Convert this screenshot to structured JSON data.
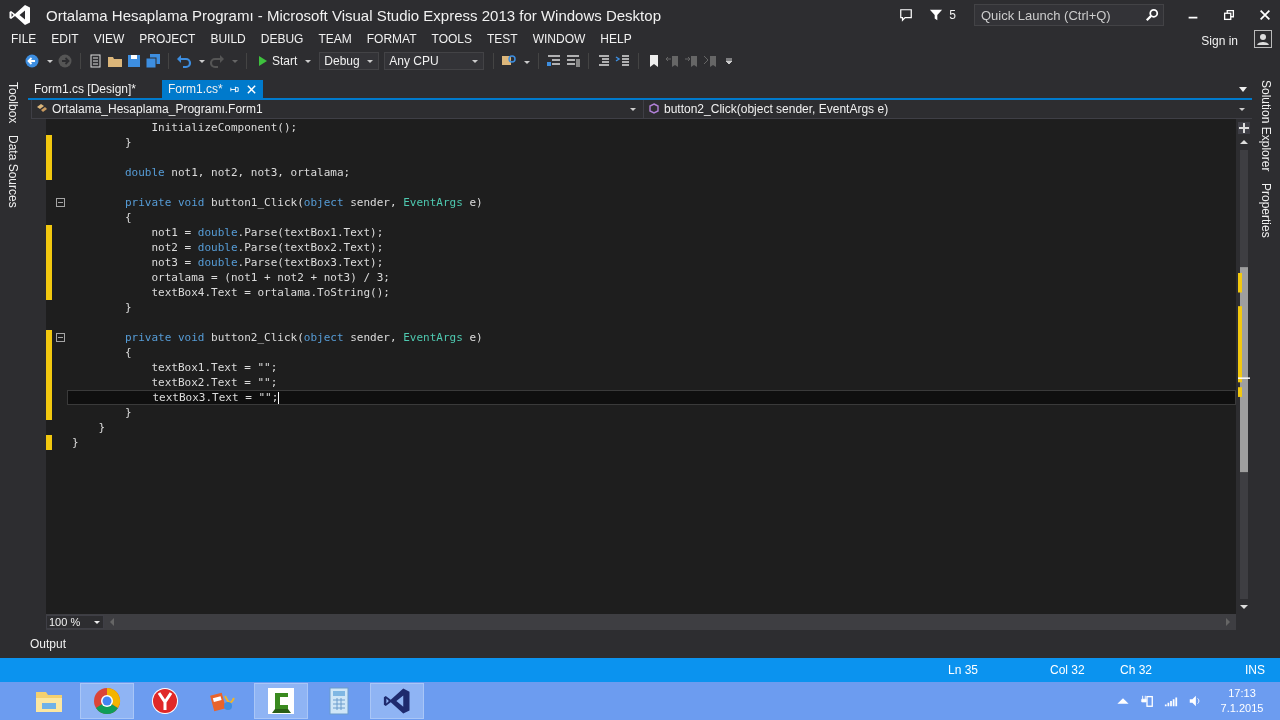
{
  "window": {
    "title": "Ortalama Hesaplama Programı - Microsoft Visual Studio Express 2013 for Windows Desktop"
  },
  "title_bar": {
    "notifications": "5",
    "quick_launch": {
      "placeholder": "Quick Launch (Ctrl+Q)"
    },
    "sign_in": "Sign in"
  },
  "menu": [
    "FILE",
    "EDIT",
    "VIEW",
    "PROJECT",
    "BUILD",
    "DEBUG",
    "TEAM",
    "FORMAT",
    "TOOLS",
    "TEST",
    "WINDOW",
    "HELP"
  ],
  "toolbar": {
    "start": "Start",
    "configuration": "Debug",
    "platform": "Any CPU"
  },
  "side_tabs_left": [
    "Toolbox",
    "Data Sources"
  ],
  "side_tabs_right": [
    "Solution Explorer",
    "Properties"
  ],
  "tabs": [
    {
      "label": "Form1.cs [Design]*",
      "selected": false
    },
    {
      "label": "Form1.cs*",
      "selected": true
    }
  ],
  "nav": {
    "class": "Ortalama_Hesaplama_Programı.Form1",
    "member": "button2_Click(object sender, EventArgs e)"
  },
  "code": [
    {
      "changed": false,
      "foldable": false,
      "current": false,
      "tokens": [
        {
          "kind": "plain",
          "text": "            InitializeComponent();"
        }
      ]
    },
    {
      "changed": true,
      "foldable": false,
      "current": false,
      "tokens": [
        {
          "kind": "plain",
          "text": "        }"
        }
      ]
    },
    {
      "changed": true,
      "foldable": false,
      "current": false
    },
    {
      "changed": true,
      "foldable": false,
      "current": false,
      "tokens": [
        {
          "kind": "keyword",
          "text": "        double"
        },
        {
          "kind": "plain",
          "text": " not1, not2, not3, ortalama;"
        }
      ]
    },
    {
      "changed": false,
      "foldable": false,
      "current": false
    },
    {
      "changed": false,
      "foldable": true,
      "current": false,
      "tokens": [
        {
          "kind": "keyword",
          "text": "        private void"
        },
        {
          "kind": "plain",
          "text": " button1_Click("
        },
        {
          "kind": "keyword",
          "text": "object"
        },
        {
          "kind": "plain",
          "text": " sender, "
        },
        {
          "kind": "type",
          "text": "EventArgs"
        },
        {
          "kind": "plain",
          "text": " e)"
        }
      ]
    },
    {
      "changed": false,
      "foldable": false,
      "current": false,
      "tokens": [
        {
          "kind": "plain",
          "text": "        {"
        }
      ]
    },
    {
      "changed": true,
      "foldable": false,
      "current": false,
      "tokens": [
        {
          "kind": "plain",
          "text": "            not1 = "
        },
        {
          "kind": "keyword",
          "text": "double"
        },
        {
          "kind": "plain",
          "text": ".Parse(textBox1.Text);"
        }
      ]
    },
    {
      "changed": true,
      "foldable": false,
      "current": false,
      "tokens": [
        {
          "kind": "plain",
          "text": "            not2 = "
        },
        {
          "kind": "keyword",
          "text": "double"
        },
        {
          "kind": "plain",
          "text": ".Parse(textBox2.Text);"
        }
      ]
    },
    {
      "changed": true,
      "foldable": false,
      "current": false,
      "tokens": [
        {
          "kind": "plain",
          "text": "            not3 = "
        },
        {
          "kind": "keyword",
          "text": "double"
        },
        {
          "kind": "plain",
          "text": ".Parse(textBox3.Text);"
        }
      ]
    },
    {
      "changed": true,
      "foldable": false,
      "current": false,
      "tokens": [
        {
          "kind": "plain",
          "text": "            ortalama = (not1 + not2 + not3) / 3;"
        }
      ]
    },
    {
      "changed": true,
      "foldable": false,
      "current": false,
      "tokens": [
        {
          "kind": "plain",
          "text": "            textBox4.Text = ortalama.ToString();"
        }
      ]
    },
    {
      "changed": false,
      "foldable": false,
      "current": false,
      "tokens": [
        {
          "kind": "plain",
          "text": "        }"
        }
      ]
    },
    {
      "changed": false,
      "foldable": false,
      "current": false
    },
    {
      "changed": true,
      "foldable": true,
      "current": false,
      "tokens": [
        {
          "kind": "keyword",
          "text": "        private void"
        },
        {
          "kind": "plain",
          "text": " button2_Click("
        },
        {
          "kind": "keyword",
          "text": "object"
        },
        {
          "kind": "plain",
          "text": " sender, "
        },
        {
          "kind": "type",
          "text": "EventArgs"
        },
        {
          "kind": "plain",
          "text": " e)"
        }
      ]
    },
    {
      "changed": true,
      "foldable": false,
      "current": false,
      "tokens": [
        {
          "kind": "plain",
          "text": "        {"
        }
      ]
    },
    {
      "changed": true,
      "foldable": false,
      "current": false,
      "tokens": [
        {
          "kind": "plain",
          "text": "            textBox1.Text = \"\";"
        }
      ]
    },
    {
      "changed": true,
      "foldable": false,
      "current": false,
      "tokens": [
        {
          "kind": "plain",
          "text": "            textBox2.Text = \"\";"
        }
      ]
    },
    {
      "changed": true,
      "foldable": false,
      "current": true,
      "tokens": [
        {
          "kind": "plain",
          "text": "            textBox3.Text = \"\";"
        }
      ]
    },
    {
      "changed": true,
      "foldable": false,
      "current": false,
      "tokens": [
        {
          "kind": "plain",
          "text": "        }"
        }
      ]
    },
    {
      "changed": false,
      "foldable": false,
      "current": false,
      "tokens": [
        {
          "kind": "plain",
          "text": "    }"
        }
      ]
    },
    {
      "changed": true,
      "foldable": false,
      "current": false,
      "tokens": [
        {
          "kind": "plain",
          "text": "}"
        }
      ]
    }
  ],
  "zoom": "100 %",
  "output_tab": "Output",
  "status_bar": {
    "line": "Ln 35",
    "column": "Col 32",
    "char": "Ch 32",
    "mode": "INS"
  },
  "taskbar": {
    "apps": [
      {
        "kind": "folder",
        "active": false
      },
      {
        "kind": "browser",
        "active": true
      },
      {
        "kind": "round",
        "active": false
      },
      {
        "kind": "film",
        "active": false
      },
      {
        "kind": "recorder",
        "active": true
      },
      {
        "kind": "calculator",
        "active": false
      },
      {
        "kind": "studio",
        "active": true
      }
    ],
    "clock": {
      "time": "17:13",
      "date": "7.1.2015"
    }
  }
}
